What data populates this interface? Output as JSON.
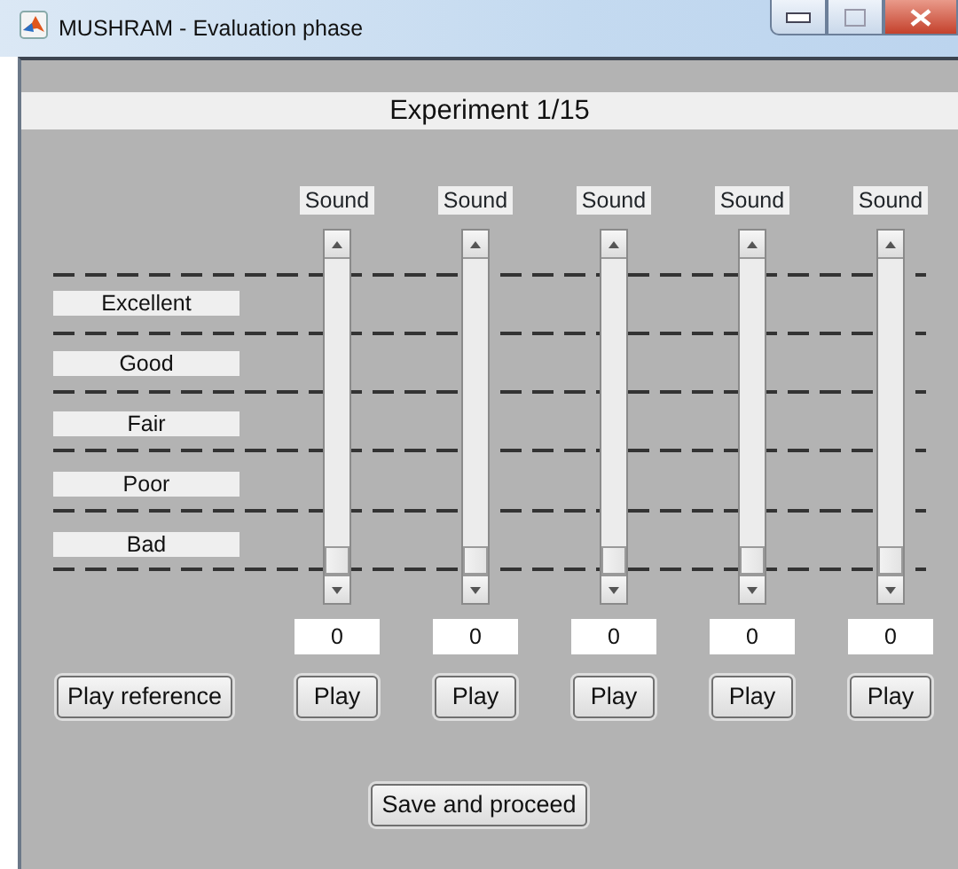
{
  "window": {
    "title": "MUSHRAM - Evaluation phase"
  },
  "header": "Experiment 1/15",
  "scale_labels": [
    "Excellent",
    "Good",
    "Fair",
    "Poor",
    "Bad"
  ],
  "sounds": [
    {
      "label": "Sound",
      "level": 0,
      "value": "0",
      "button": "Play"
    },
    {
      "label": "Sound",
      "level": 0,
      "value": "0",
      "button": "Play"
    },
    {
      "label": "Sound",
      "level": 0,
      "value": "0",
      "button": "Play"
    },
    {
      "label": "Sound",
      "level": 0,
      "value": "0",
      "button": "Play"
    },
    {
      "label": "Sound",
      "level": 0,
      "value": "0",
      "button": "Play"
    }
  ],
  "reference_button": "Play reference",
  "save_button": "Save and proceed"
}
